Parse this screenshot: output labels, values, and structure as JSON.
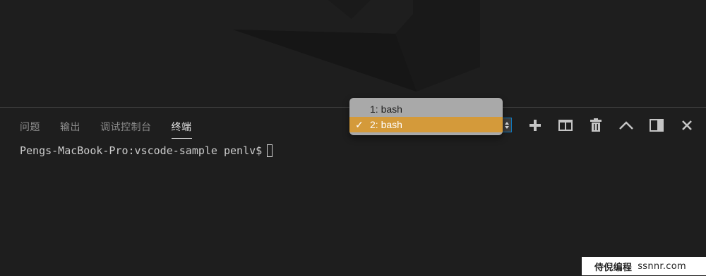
{
  "panel": {
    "tabs": [
      {
        "label": "问题",
        "active": false
      },
      {
        "label": "输出",
        "active": false
      },
      {
        "label": "调试控制台",
        "active": false
      },
      {
        "label": "终端",
        "active": true
      }
    ]
  },
  "terminal": {
    "prompt": "Pengs-MacBook-Pro:vscode-sample penlv$",
    "selected_index": 2
  },
  "dropdown": {
    "options": [
      "1: bash",
      "2: bash"
    ],
    "selected": "2: bash"
  },
  "actions": [
    {
      "name": "new-terminal-icon"
    },
    {
      "name": "split-terminal-icon"
    },
    {
      "name": "kill-terminal-icon"
    },
    {
      "name": "maximize-panel-icon"
    },
    {
      "name": "toggle-panel-position-icon"
    },
    {
      "name": "close-panel-icon"
    }
  ],
  "footer": {
    "brand_zh": "侍倪编程",
    "brand_domain": "ssnnr.com"
  },
  "colors": {
    "background": "#1e1e1e",
    "selection": "#d49a3a",
    "dropdown_bg": "#a9a9a9",
    "active_tab": "#e7e7e7",
    "inactive_tab": "#8c8c8c"
  }
}
